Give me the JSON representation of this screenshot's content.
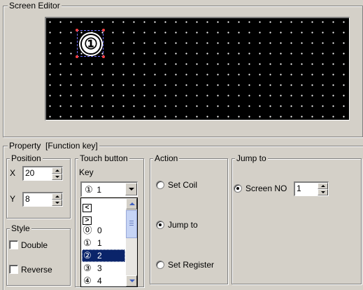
{
  "screen_editor": {
    "title": "Screen Editor",
    "function_key_number": "①"
  },
  "property": {
    "title": "Property  [Function key]"
  },
  "position": {
    "title": "Position",
    "x_label": "X",
    "x_value": "20",
    "y_label": "Y",
    "y_value": "8"
  },
  "style": {
    "title": "Style",
    "double_label": "Double",
    "double_checked": false,
    "reverse_label": "Reverse",
    "reverse_checked": false
  },
  "touch_button": {
    "title": "Touch button",
    "key_label": "Key",
    "selected_glyph": "①",
    "selected_value": "1",
    "list": [
      {
        "glyph": "<",
        "boxed": true,
        "text": "",
        "selected": false
      },
      {
        "glyph": ">",
        "boxed": true,
        "text": "",
        "selected": false
      },
      {
        "glyph": "⓪",
        "boxed": false,
        "text": "0",
        "selected": false
      },
      {
        "glyph": "①",
        "boxed": false,
        "text": "1",
        "selected": false
      },
      {
        "glyph": "②",
        "boxed": false,
        "text": "2",
        "selected": true
      },
      {
        "glyph": "③",
        "boxed": false,
        "text": "3",
        "selected": false
      },
      {
        "glyph": "④",
        "boxed": false,
        "text": "4",
        "selected": false
      }
    ]
  },
  "action": {
    "title": "Action",
    "options": [
      "Set Coil",
      "Jump to",
      "Set Register"
    ],
    "selected": "Jump to"
  },
  "jump_to": {
    "title": "Jump to",
    "screen_no_label": "Screen NO",
    "screen_no_value": "1",
    "screen_no_selected": true
  }
}
